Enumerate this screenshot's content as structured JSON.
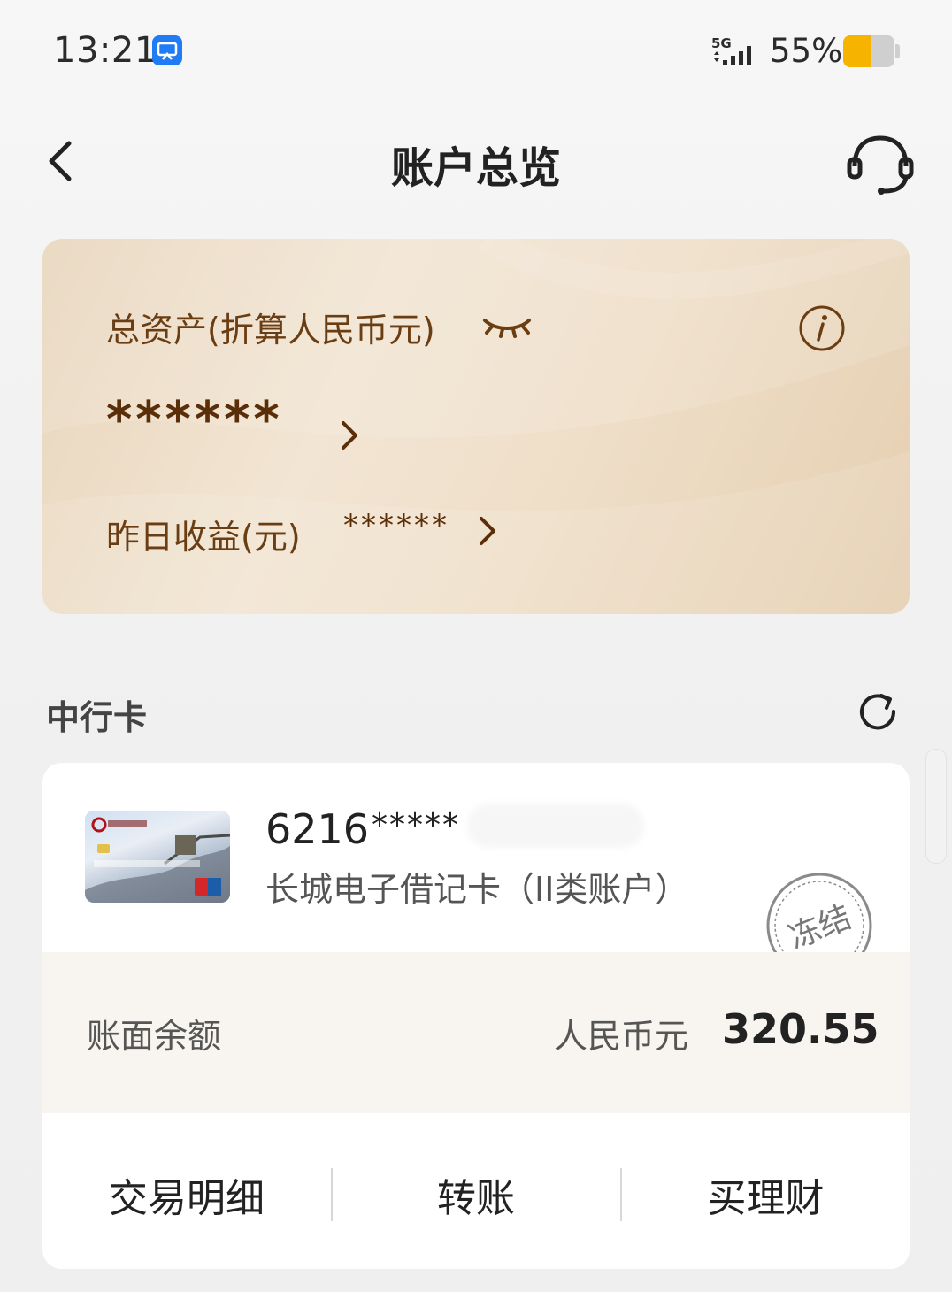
{
  "status_bar": {
    "time": "13:21",
    "network": "5G",
    "battery_percent": "55%",
    "battery_level": 0.55
  },
  "header": {
    "title": "账户总览"
  },
  "assets": {
    "total_label": "总资产(折算人民币元)",
    "total_value": "******",
    "yesterday_label": "昨日收益(元)",
    "yesterday_value": "******"
  },
  "section": {
    "title": "中行卡"
  },
  "account": {
    "card_number_prefix": "6216",
    "card_number_mask": "*****",
    "card_type": "长城电子借记卡（II类账户）",
    "status_stamp": "冻结",
    "balance_label": "账面余额",
    "currency": "人民币元",
    "balance": "320.55",
    "actions": [
      "交易明细",
      "转账",
      "买理财"
    ]
  },
  "colors": {
    "accent_brown": "#6a3d12",
    "card_gold": "#e8d6bd"
  }
}
